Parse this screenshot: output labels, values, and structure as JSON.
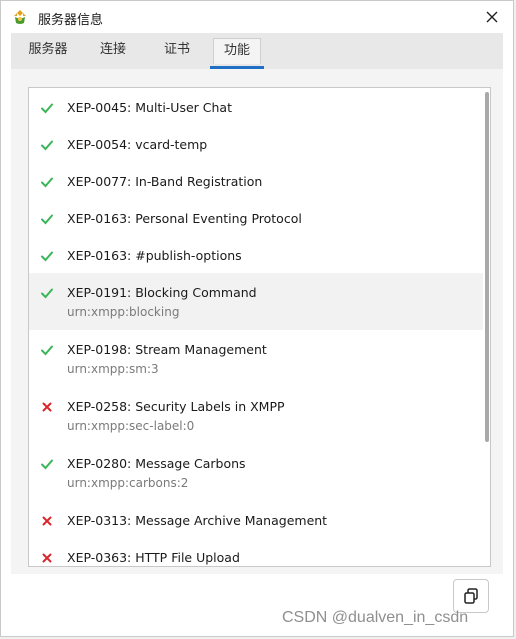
{
  "window": {
    "title": "服务器信息"
  },
  "tabs": [
    {
      "label": "服务器",
      "active": false
    },
    {
      "label": "连接",
      "active": false
    },
    {
      "label": "证书",
      "active": false
    },
    {
      "label": "功能",
      "active": true
    }
  ],
  "colors": {
    "success": "#3cb55a",
    "fail": "#d9262d",
    "accent": "#1f6fc5"
  },
  "features": [
    {
      "title": "XEP-0045: Multi-User Chat",
      "subtitle": "",
      "supported": true,
      "icon": "check-icon"
    },
    {
      "title": "XEP-0054: vcard-temp",
      "subtitle": "",
      "supported": true,
      "icon": "check-icon"
    },
    {
      "title": "XEP-0077: In-Band Registration",
      "subtitle": "",
      "supported": true,
      "icon": "check-icon"
    },
    {
      "title": "XEP-0163: Personal Eventing Protocol",
      "subtitle": "",
      "supported": true,
      "icon": "check-icon"
    },
    {
      "title": "XEP-0163: #publish-options",
      "subtitle": "",
      "supported": true,
      "icon": "check-icon"
    },
    {
      "title": "XEP-0191: Blocking Command",
      "subtitle": "urn:xmpp:blocking",
      "supported": true,
      "icon": "check-icon",
      "highlighted": true
    },
    {
      "title": "XEP-0198: Stream Management",
      "subtitle": "urn:xmpp:sm:3",
      "supported": true,
      "icon": "check-icon"
    },
    {
      "title": "XEP-0258: Security Labels in XMPP",
      "subtitle": "urn:xmpp:sec-label:0",
      "supported": false,
      "icon": "cross-icon"
    },
    {
      "title": "XEP-0280: Message Carbons",
      "subtitle": "urn:xmpp:carbons:2",
      "supported": true,
      "icon": "check-icon"
    },
    {
      "title": "XEP-0313: Message Archive Management",
      "subtitle": "",
      "supported": false,
      "icon": "cross-icon"
    },
    {
      "title": "XEP-0363: HTTP File Upload",
      "subtitle": "",
      "supported": false,
      "icon": "cross-icon"
    }
  ],
  "watermark": "CSDN @dualven_in_csdn"
}
